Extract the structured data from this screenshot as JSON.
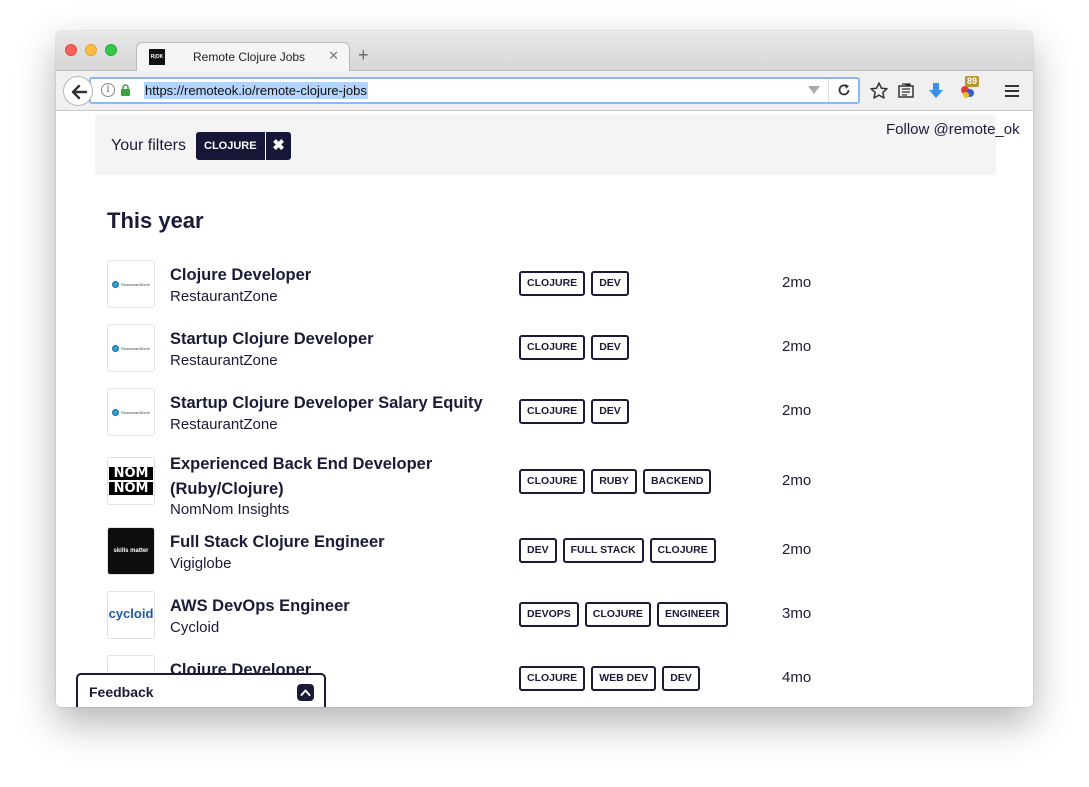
{
  "browser": {
    "tab_title": "Remote Clojure Jobs",
    "tab_favicon_text": "R|OK",
    "url": "https://remoteok.io/remote-clojure-jobs",
    "extension_badge": "89"
  },
  "filters": {
    "label": "Your filters",
    "active_filter": "CLOJURE",
    "follow_text": "Follow @remote_ok"
  },
  "section_title": "This year",
  "jobs": [
    {
      "title": "Clojure Developer",
      "company": "RestaurantZone",
      "logo": "RestaurantZone",
      "tags": [
        "CLOJURE",
        "DEV"
      ],
      "age": "2mo"
    },
    {
      "title": "Startup Clojure Developer",
      "company": "RestaurantZone",
      "logo": "RestaurantZone",
      "tags": [
        "CLOJURE",
        "DEV"
      ],
      "age": "2mo"
    },
    {
      "title": "Startup Clojure Developer Salary Equity",
      "company": "RestaurantZone",
      "logo": "RestaurantZone",
      "tags": [
        "CLOJURE",
        "DEV"
      ],
      "age": "2mo"
    },
    {
      "title": "Experienced Back End Developer (Ruby/Clojure)",
      "company": "NomNom Insights",
      "logo": "NOM NOM",
      "tags": [
        "CLOJURE",
        "RUBY",
        "BACKEND"
      ],
      "age": "2mo"
    },
    {
      "title": "Full Stack Clojure Engineer",
      "company": "Vigiglobe",
      "logo": "skills matter",
      "tags": [
        "DEV",
        "FULL STACK",
        "CLOJURE"
      ],
      "age": "2mo"
    },
    {
      "title": "AWS DevOps Engineer",
      "company": "Cycloid",
      "logo": "cycloid",
      "tags": [
        "DEVOPS",
        "CLOJURE",
        "ENGINEER"
      ],
      "age": "3mo"
    },
    {
      "title": "Clojure Developer",
      "company": "",
      "logo": "",
      "tags": [
        "CLOJURE",
        "WEB DEV",
        "DEV"
      ],
      "age": "4mo"
    }
  ],
  "feedback": {
    "label": "Feedback"
  }
}
